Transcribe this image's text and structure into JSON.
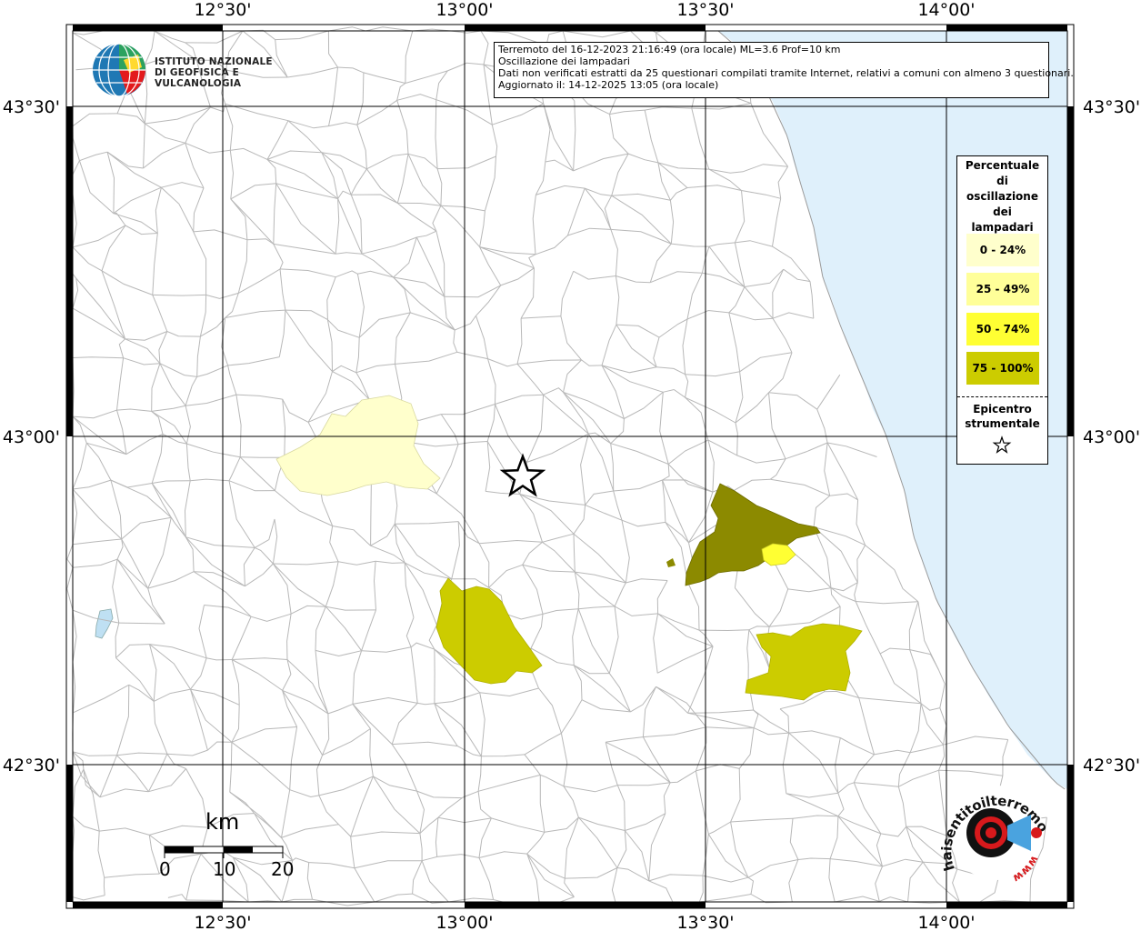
{
  "map": {
    "top_labels": [
      "12°30'",
      "13°00'",
      "13°30'",
      "14°00'"
    ],
    "bottom_labels": [
      "12°30'",
      "13°00'",
      "13°30'",
      "14°00'"
    ],
    "left_labels": [
      "43°30'",
      "43°00'",
      "42°30'"
    ],
    "right_labels": [
      "43°30'",
      "43°00'",
      "42°30'"
    ],
    "colors": {
      "sea": "#dff0fb",
      "land": "#ffffff",
      "border": "#b8b8b8",
      "class_0_24": "#ffffcc",
      "class_25_49": "#ffff99",
      "class_50_74": "#ffff33",
      "class_75_100": "#cccc00",
      "class_dark": "#8c8a00"
    }
  },
  "info": {
    "line1": "Terremoto del 16-12-2023 21:16:49 (ora locale) ML=3.6 Prof=10 km",
    "line2": "Oscillazione dei lampadari",
    "line3": "Dati non verificati estratti da 25 questionari compilati tramite Internet, relativi a comuni con almeno 3 questionari.",
    "line4": "Aggiornato il: 14-12-2025 13:05 (ora locale)"
  },
  "logo": {
    "line1": "ISTITUTO NAZIONALE",
    "line2": "DI GEOFISICA E VULCANOLOGIA"
  },
  "legend": {
    "title_lines": [
      "Percentuale",
      "di",
      "oscillazione",
      "dei",
      "lampadari"
    ],
    "items": [
      {
        "label": "0 - 24%",
        "color": "#ffffcc"
      },
      {
        "label": "25 - 49%",
        "color": "#ffff99"
      },
      {
        "label": "50 - 74%",
        "color": "#ffff33"
      },
      {
        "label": "75 - 100%",
        "color": "#cccc00"
      }
    ],
    "epicenter_lines": [
      "Epicentro",
      "strumentale"
    ],
    "epicenter_icon": "star-icon"
  },
  "scale": {
    "unit": "km",
    "ticks": [
      "0",
      "10",
      "20"
    ]
  },
  "badge": {
    "text_main": "haisentitoilterremoto.it",
    "text_www": "www",
    "icon": "megaphone-icon"
  }
}
